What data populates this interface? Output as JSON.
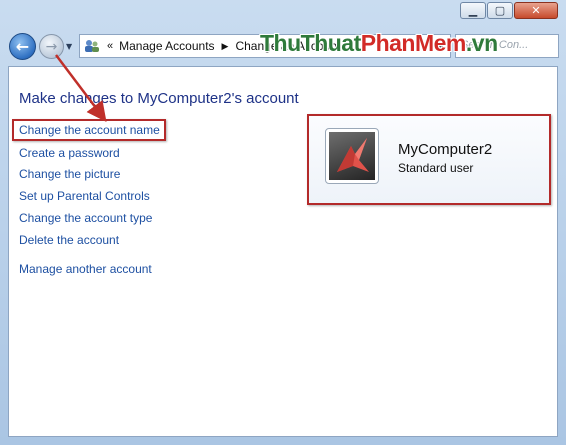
{
  "window": {
    "minimize_glyph": "▁",
    "maximize_glyph": "▢",
    "close_glyph": "✕"
  },
  "nav": {
    "back_glyph": "←",
    "forward_glyph": "→",
    "breadcrumb": [
      "Manage Accounts",
      "Change an Account"
    ],
    "chevron_glyph": "«",
    "separator_glyph": "▶",
    "search_placeholder": "Search Con..."
  },
  "page": {
    "title": "Make changes to MyComputer2's account",
    "links": [
      "Change the account name",
      "Create a password",
      "Change the picture",
      "Set up Parental Controls",
      "Change the account type",
      "Delete the account"
    ],
    "other_link": "Manage another account"
  },
  "user": {
    "name": "MyComputer2",
    "type": "Standard user"
  },
  "watermark": {
    "part1": "ThuThuat",
    "part2": "PhanMem",
    "part3": ".vn"
  },
  "colors": {
    "link": "#1e50a2",
    "title": "#1e3287",
    "highlight": "#b32a2a"
  }
}
